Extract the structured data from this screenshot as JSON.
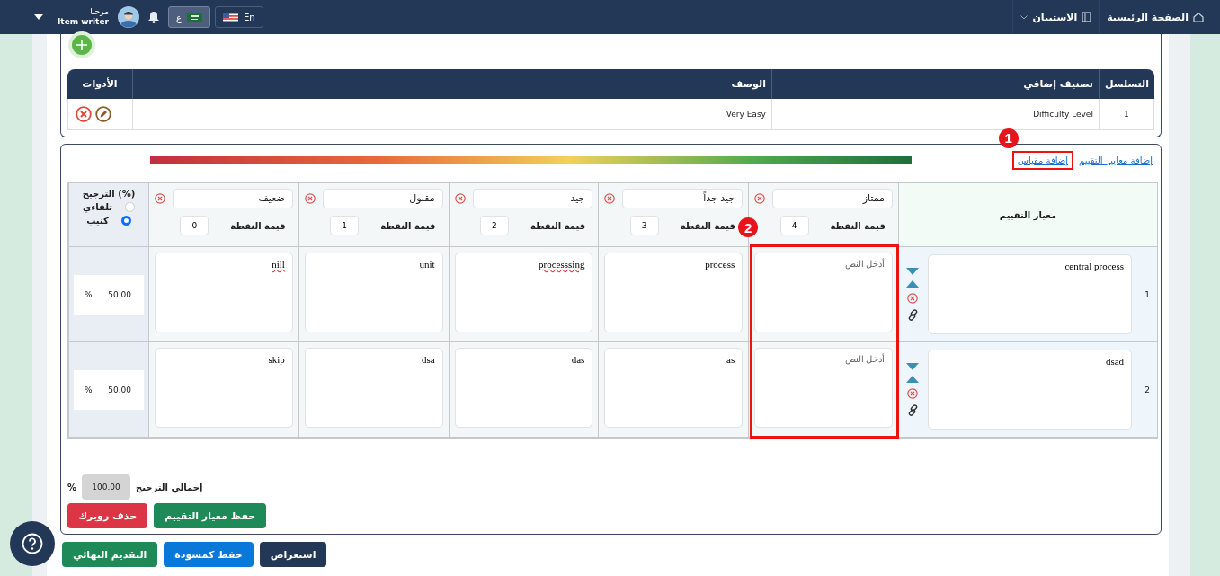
{
  "topbar": {
    "nav": [
      {
        "label": "الصفحة الرئيسية",
        "kind": "home"
      },
      {
        "label": "الاستبيان",
        "kind": "dropdown"
      }
    ],
    "languages": [
      {
        "label": "En",
        "kind": "en",
        "selected": false
      },
      {
        "label": "ع",
        "kind": "ar",
        "selected": true
      }
    ],
    "user": {
      "greeting": "مرحبا",
      "role": "Item writer"
    }
  },
  "classification_table": {
    "columns": [
      "التسلسل",
      "تصنيف إضافي",
      "الوصف",
      "الأدوات"
    ],
    "rows": [
      {
        "index": "1",
        "classification": "Difficulty Level",
        "description": "Very Easy"
      }
    ]
  },
  "rubric": {
    "links": [
      {
        "label": "إضافة معايير التقييم"
      },
      {
        "label": "إضافة مقياس",
        "annotation": "1"
      }
    ],
    "criteria_header": "معيار التقييم",
    "levels": [
      {
        "name": "ممتاز",
        "points_label": "قيمة النقطة",
        "points": "4",
        "annotation": "2"
      },
      {
        "name": "جيد جداً",
        "points_label": "قيمة النقطة",
        "points": "3"
      },
      {
        "name": "جيد",
        "points_label": "قيمة النقطة",
        "points": "2"
      },
      {
        "name": "مقبول",
        "points_label": "قيمة النقطة",
        "points": "1"
      },
      {
        "name": "ضعيف",
        "points_label": "قيمة النقطة",
        "points": "0"
      }
    ],
    "weighting": {
      "title": "(%) الترجيح",
      "options": [
        {
          "label": "تلقاءي",
          "selected": false
        },
        {
          "label": "كتيب",
          "selected": true
        }
      ]
    },
    "criteria": [
      {
        "index": "1",
        "text": "central process",
        "weight": "50.00",
        "unit": "%",
        "cells": [
          {
            "placeholder": "أدخل النص"
          },
          {
            "value": "process",
            "misspelled": false
          },
          {
            "value": "processsing",
            "misspelled": true
          },
          {
            "value": "unit",
            "misspelled": false
          },
          {
            "value": "nill",
            "misspelled": true
          }
        ]
      },
      {
        "index": "2",
        "text": "dsad",
        "weight": "50.00",
        "unit": "%",
        "cells": [
          {
            "placeholder": "أدخل النص"
          },
          {
            "value": "as",
            "misspelled": false
          },
          {
            "value": "das",
            "misspelled": false
          },
          {
            "value": "dsa",
            "misspelled": false
          },
          {
            "value": "skip",
            "misspelled": false
          }
        ]
      }
    ],
    "total": {
      "label": "إجمالي الترجيح",
      "value": "100.00",
      "unit": "%"
    },
    "buttons": [
      {
        "label": "حفظ معيار التقييم",
        "kind": "success"
      },
      {
        "label": "حذف روبرك",
        "kind": "danger"
      }
    ]
  },
  "footer_buttons": [
    {
      "label": "استعراض",
      "kind": "dark"
    },
    {
      "label": "حفظ كمسودة",
      "kind": "primary"
    },
    {
      "label": "التقديم النهائي",
      "kind": "success"
    }
  ]
}
